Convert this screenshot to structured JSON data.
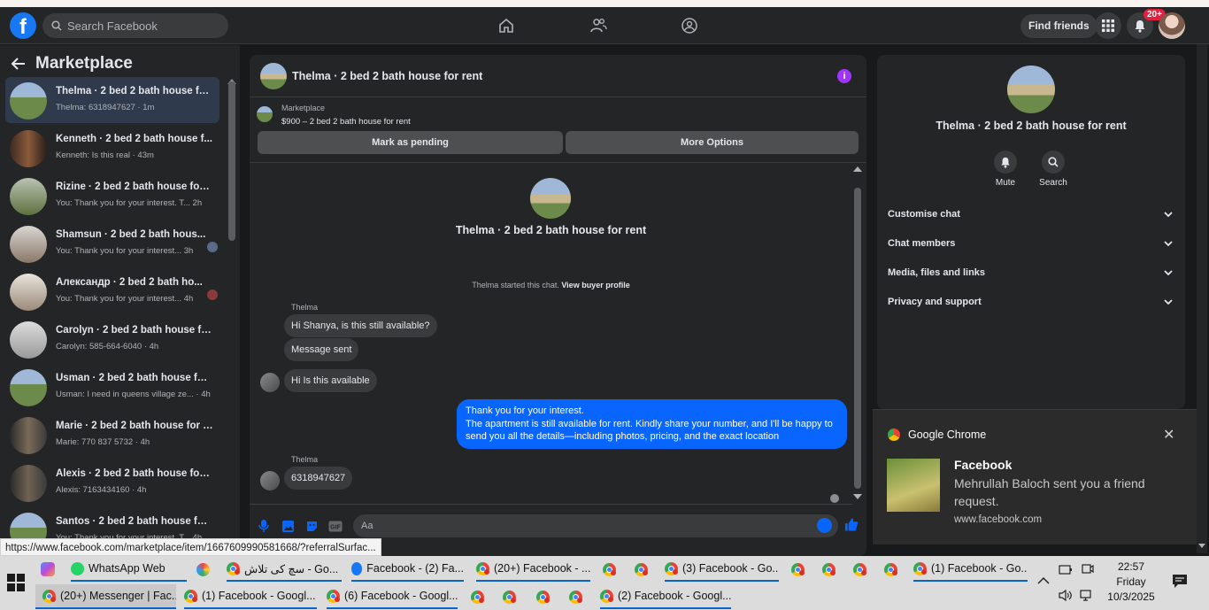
{
  "facebook": {
    "logo": "f",
    "search_placeholder": "Search Facebook",
    "find_friends": "Find friends",
    "notif_badge": "20+"
  },
  "sidebar": {
    "title": "Marketplace",
    "chats": [
      {
        "title": "Thelma · 2 bed 2 bath house fo...",
        "sub": "Thelma: 6318947627 · 1m",
        "active": true
      },
      {
        "title": "Kenneth · 2 bed 2 bath house f...",
        "sub": "Kenneth: Is this real · 43m"
      },
      {
        "title": "Rizine · 2 bed 2 bath house for ...",
        "sub": "You: Thank you for your interest. T...  2h"
      },
      {
        "title": "Shamsun · 2 bed 2 bath hous...",
        "sub": "You: Thank you for your interest... 3h"
      },
      {
        "title": "Александр · 2 bed 2 bath ho...",
        "sub": "You: Thank you for your interest... 4h"
      },
      {
        "title": "Carolyn · 2 bed 2 bath house fo...",
        "sub": "Carolyn: 585-664-6040 · 4h"
      },
      {
        "title": "Usman · 2 bed 2 bath house for...",
        "sub": "Usman: I need in queens village ze... · 4h"
      },
      {
        "title": "Marie · 2 bed 2 bath house for r...",
        "sub": "Marie: 770 837 5732 · 4h"
      },
      {
        "title": "Alexis · 2 bed 2 bath house for ...",
        "sub": "Alexis: 7163434160 · 4h"
      },
      {
        "title": "Santos · 2 bed 2 bath house for...",
        "sub": "You: Thank you for your interest. T...  4h"
      }
    ]
  },
  "conversation": {
    "title": "Thelma · 2 bed 2 bath house for rent",
    "marketplace_label": "Marketplace",
    "listing": "$900 – 2 bed 2 bath house for rent",
    "mark_pending": "Mark as pending",
    "more_options": "More Options",
    "intro_title": "Thelma · 2 bed 2 bath house for rent",
    "started_text": "Thelma started this chat.",
    "view_profile": "View buyer profile",
    "sender_name": "Thelma",
    "messages": {
      "m1": "Hi Shanya, is this still available?",
      "m2": "Message sent",
      "m3": "Hi Is this available",
      "m4_line1": "Thank you for your interest.",
      "m4_line2": "The apartment is still available for rent. Kindly share your number, and I'll be happy to send you all the details—including photos, pricing, and the exact location",
      "m5": "6318947627"
    },
    "composer_placeholder": "Aa"
  },
  "right_panel": {
    "title": "Thelma · 2 bed 2 bath house for rent",
    "mute": "Mute",
    "search": "Search",
    "sections": [
      "Customise chat",
      "Chat members",
      "Media, files and links",
      "Privacy and support"
    ]
  },
  "notification": {
    "app": "Google Chrome",
    "title": "Facebook",
    "body": "Mehrullah Baloch sent you a friend request.",
    "url": "www.facebook.com"
  },
  "status_url": "https://www.facebook.com/marketplace/item/1667609990581668/?referralSurfac...",
  "taskbar": {
    "row1": {
      "whatsapp": "WhatsApp Web",
      "tab1": "سچ کی تلاش - Go...",
      "tab2": "Facebook - (2) Fa...",
      "tab3": "(20+) Facebook - ...",
      "tab4": "(3) Facebook - Go...",
      "tab5": "(1) Facebook - Go..."
    },
    "row2": {
      "tab1": "(20+) Messenger | Fac...",
      "tab2": "(1) Facebook - Googl...",
      "tab3": "(6) Facebook - Googl...",
      "tab4": "(2) Facebook - Googl..."
    },
    "time": "22:57",
    "day": "Friday",
    "date": "10/3/2025"
  }
}
